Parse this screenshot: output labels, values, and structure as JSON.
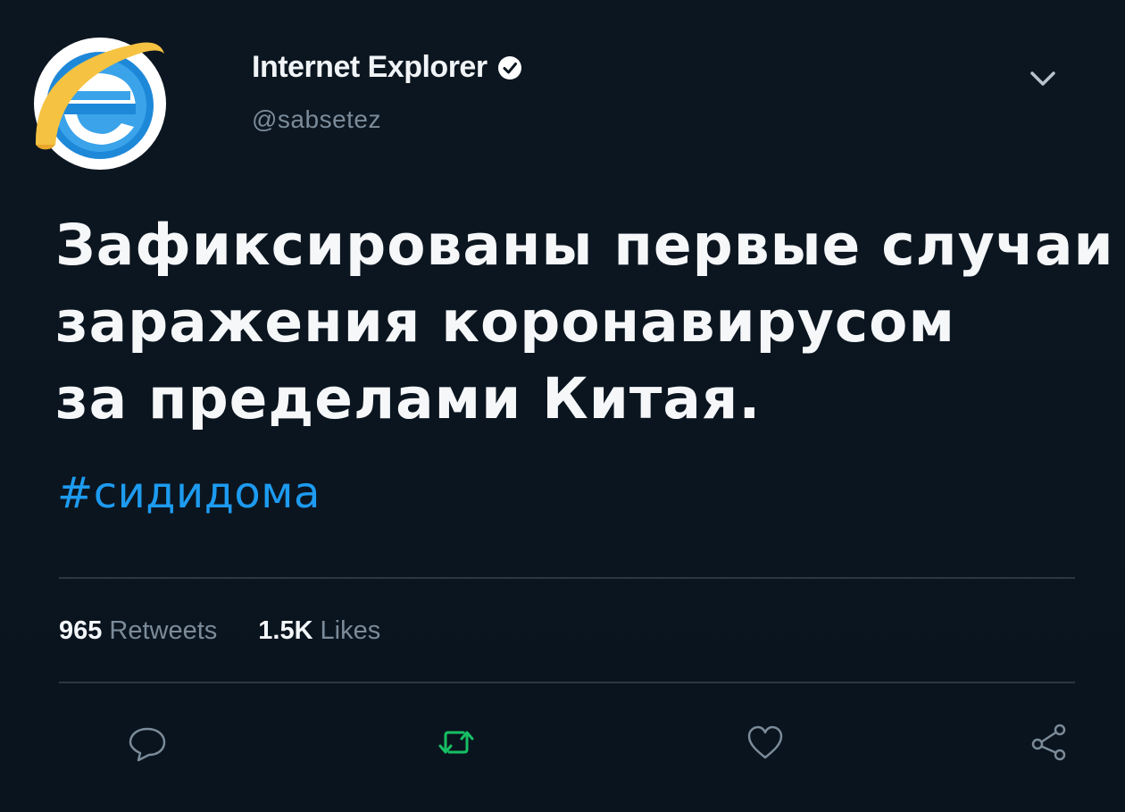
{
  "header": {
    "display_name": "Internet Explorer",
    "handle": "@sabsetez",
    "avatar_icon": "internet-explorer-logo",
    "verified_icon": "verified-badge-icon"
  },
  "tweet": {
    "lines": [
      "Зафиксированы первые случаи",
      "заражения коронавирусом",
      "за пределами Китая."
    ],
    "hashtag": "#сидидома"
  },
  "stats": {
    "retweets_count": "965",
    "retweets_label": "Retweets",
    "likes_count": "1.5K",
    "likes_label": "Likes"
  },
  "actions": {
    "reply_icon": "reply-icon",
    "retweet_icon": "retweet-icon",
    "like_icon": "heart-icon",
    "share_icon": "share-icon"
  },
  "colors": {
    "background": "#0b1520",
    "text": "#f5f7f9",
    "secondary_text": "#7b8b99",
    "hashtag": "#1d9bf0",
    "retweet_active": "#17bf63",
    "divider": "#2b3742"
  }
}
